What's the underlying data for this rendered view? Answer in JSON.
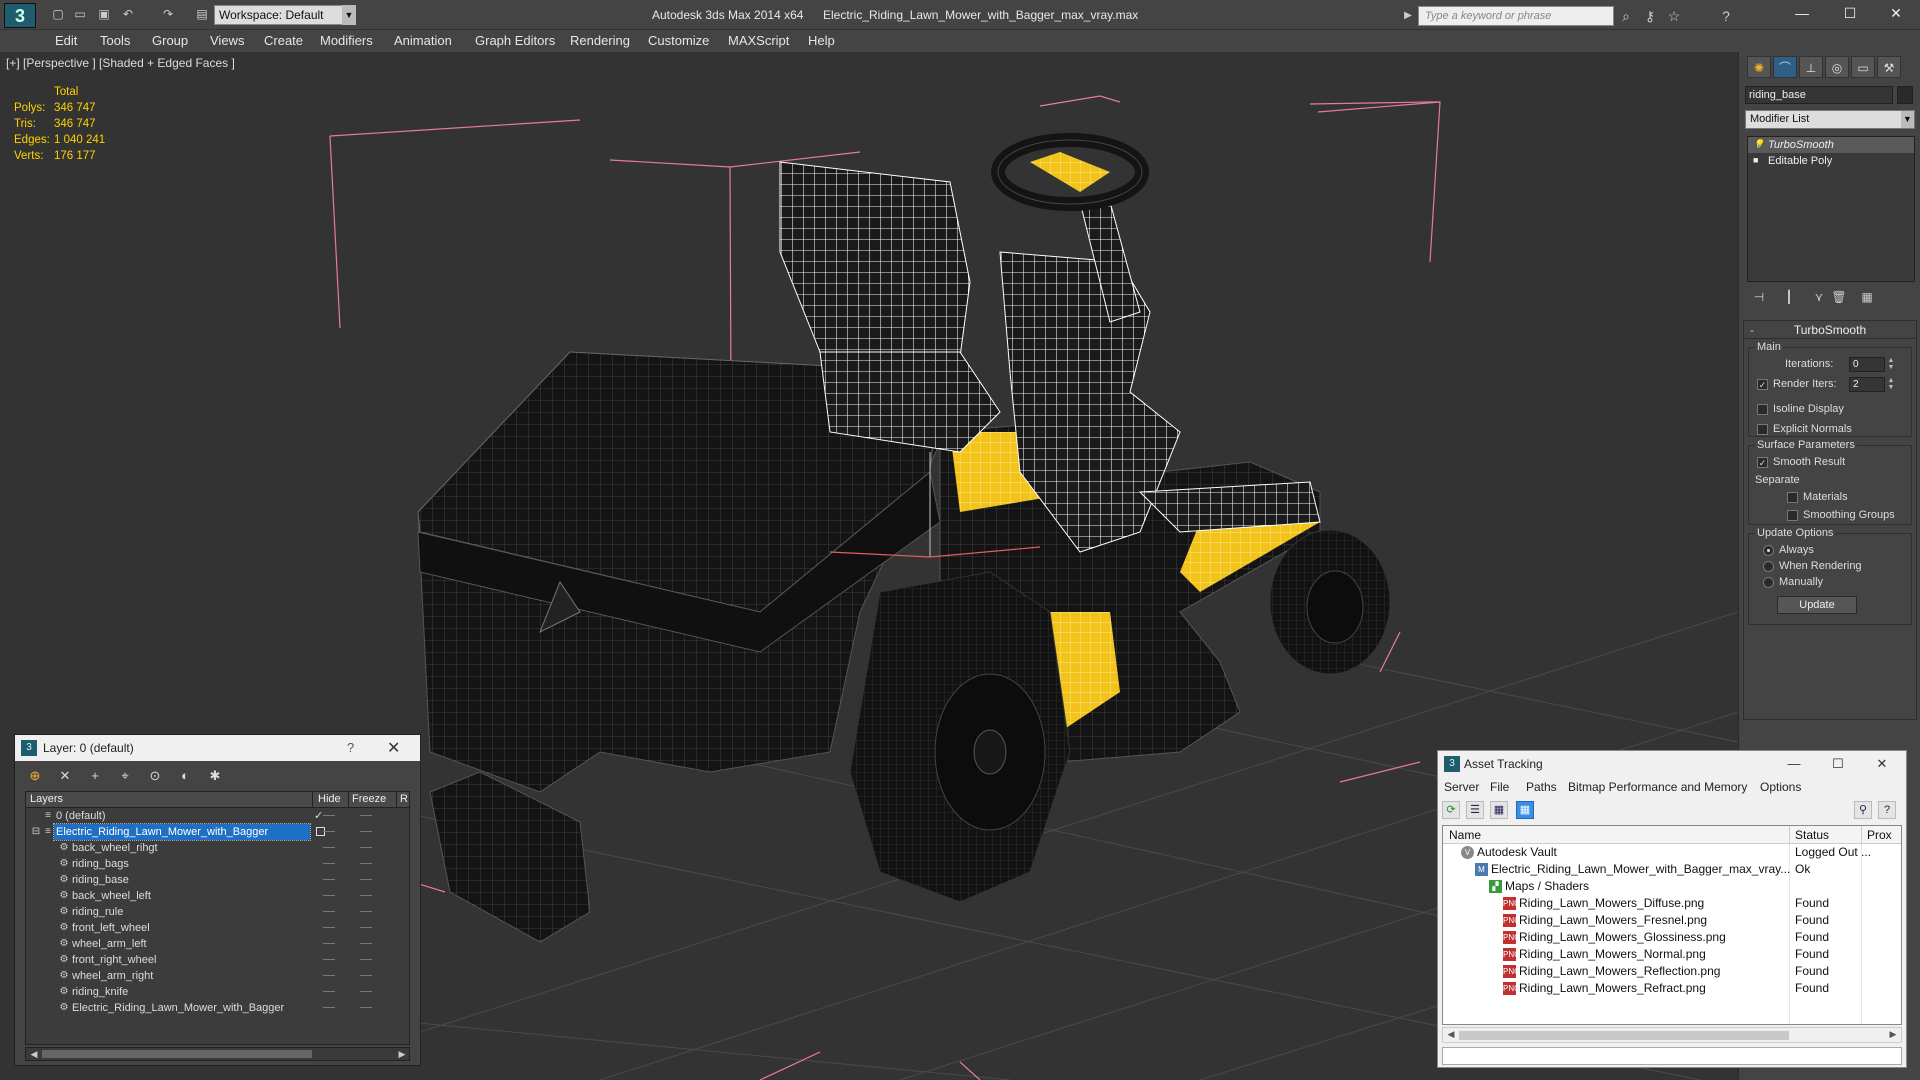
{
  "titlebar": {
    "app_title": "Autodesk 3ds Max  2014 x64",
    "file_title": "Electric_Riding_Lawn_Mower_with_Bagger_max_vray.max",
    "workspace_label": "Workspace: Default",
    "search_placeholder": "Type a keyword or phrase",
    "logo_icon": "3ds-max-logo-icon",
    "quick_access_icons": [
      "new-file-icon",
      "open-file-icon",
      "save-icon",
      "undo-icon",
      "redo-icon",
      "project-folder-icon"
    ],
    "help_icons": [
      "binoculars-icon",
      "key-icon",
      "star-icon",
      "help-icon"
    ]
  },
  "menu": [
    "Edit",
    "Tools",
    "Group",
    "Views",
    "Create",
    "Modifiers",
    "Animation",
    "Graph Editors",
    "Rendering",
    "Customize",
    "MAXScript",
    "Help"
  ],
  "viewport": {
    "label": "[+] [Perspective ] [Shaded + Edged Faces ]",
    "stats": {
      "header": "Total",
      "rows": [
        {
          "label": "Polys:",
          "value": "346 747"
        },
        {
          "label": "Tris:",
          "value": "346 747"
        },
        {
          "label": "Edges:",
          "value": "1 040 241"
        },
        {
          "label": "Verts:",
          "value": "176 177"
        }
      ]
    },
    "colors": {
      "background": "#333333",
      "grid": "#4a4a4a",
      "bbox": "#e87a9a",
      "mesh_body": "#141414",
      "accent": "#f2c31a",
      "wire": "#ffffff",
      "stats": "#ffd200"
    }
  },
  "command_panel": {
    "object_name": "riding_base",
    "modifier_list": "Modifier List",
    "stack": [
      {
        "name": "TurboSmooth",
        "selected": true
      },
      {
        "name": "Editable Poly",
        "selected": false
      }
    ],
    "rollout": {
      "title": "TurboSmooth",
      "main_group": "Main",
      "iterations_label": "Iterations:",
      "iterations_value": "0",
      "render_iters_label": "Render Iters:",
      "render_iters_value": "2",
      "isoline_label": "Isoline Display",
      "explicit_label": "Explicit Normals",
      "surface_group": "Surface Parameters",
      "smooth_result_label": "Smooth Result",
      "separate_label": "Separate",
      "materials_label": "Materials",
      "smoothing_groups_label": "Smoothing Groups",
      "update_group": "Update Options",
      "always_label": "Always",
      "when_rendering_label": "When Rendering",
      "manually_label": "Manually",
      "update_button": "Update"
    }
  },
  "layer_window": {
    "title": "Layer: 0 (default)",
    "help": "?",
    "headers": {
      "layers": "Layers",
      "hide": "Hide",
      "freeze": "Freeze",
      "render": "R"
    },
    "rows": [
      {
        "name": "0 (default)",
        "level": 1,
        "selected": false,
        "current": true
      },
      {
        "name": "Electric_Riding_Lawn_Mower_with_Bagger",
        "level": 1,
        "selected": true,
        "current": false
      },
      {
        "name": "back_wheel_rihgt",
        "level": 2,
        "selected": false,
        "current": false
      },
      {
        "name": "riding_bags",
        "level": 2,
        "selected": false,
        "current": false
      },
      {
        "name": "riding_base",
        "level": 2,
        "selected": false,
        "current": false
      },
      {
        "name": "back_wheel_left",
        "level": 2,
        "selected": false,
        "current": false
      },
      {
        "name": "riding_rule",
        "level": 2,
        "selected": false,
        "current": false
      },
      {
        "name": "front_left_wheel",
        "level": 2,
        "selected": false,
        "current": false
      },
      {
        "name": "wheel_arm_left",
        "level": 2,
        "selected": false,
        "current": false
      },
      {
        "name": "front_right_wheel",
        "level": 2,
        "selected": false,
        "current": false
      },
      {
        "name": "wheel_arm_right",
        "level": 2,
        "selected": false,
        "current": false
      },
      {
        "name": "riding_knife",
        "level": 2,
        "selected": false,
        "current": false
      },
      {
        "name": "Electric_Riding_Lawn_Mower_with_Bagger",
        "level": 2,
        "selected": false,
        "current": false
      }
    ]
  },
  "asset_window": {
    "title": "Asset Tracking",
    "menu": [
      "Server",
      "File",
      "Paths",
      "Bitmap Performance and Memory",
      "Options"
    ],
    "headers": {
      "name": "Name",
      "status": "Status",
      "proxy": "Prox"
    },
    "rows": [
      {
        "name": "Autodesk Vault",
        "status": "Logged Out ...",
        "level": 1,
        "icon": "vault-icon"
      },
      {
        "name": "Electric_Riding_Lawn_Mower_with_Bagger_max_vray....",
        "status": "Ok",
        "level": 2,
        "icon": "max-file-icon"
      },
      {
        "name": "Maps / Shaders",
        "status": "",
        "level": 3,
        "icon": "maps-icon"
      },
      {
        "name": "Riding_Lawn_Mowers_Diffuse.png",
        "status": "Found",
        "level": 4,
        "icon": "png-file-icon"
      },
      {
        "name": "Riding_Lawn_Mowers_Fresnel.png",
        "status": "Found",
        "level": 4,
        "icon": "png-file-icon"
      },
      {
        "name": "Riding_Lawn_Mowers_Glossiness.png",
        "status": "Found",
        "level": 4,
        "icon": "png-file-icon"
      },
      {
        "name": "Riding_Lawn_Mowers_Normal.png",
        "status": "Found",
        "level": 4,
        "icon": "png-file-icon"
      },
      {
        "name": "Riding_Lawn_Mowers_Reflection.png",
        "status": "Found",
        "level": 4,
        "icon": "png-file-icon"
      },
      {
        "name": "Riding_Lawn_Mowers_Refract.png",
        "status": "Found",
        "level": 4,
        "icon": "png-file-icon"
      }
    ]
  }
}
